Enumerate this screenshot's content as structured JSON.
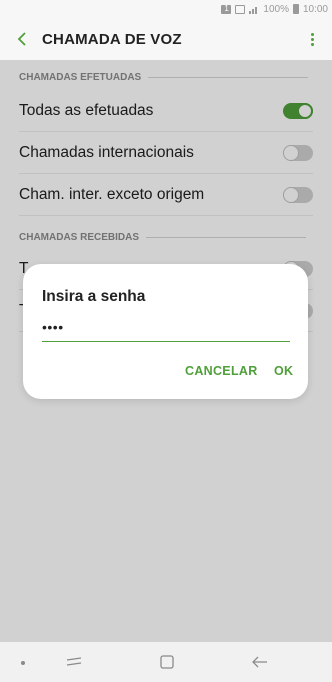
{
  "status_bar": {
    "sim_label": "1",
    "battery_percent": "100%",
    "time": "10:00",
    "icon_color": "#9a9a9a"
  },
  "app_bar": {
    "title": "CHAMADA DE VOZ",
    "back_icon": "back-arrow-icon",
    "more_icon": "more-vert-icon"
  },
  "sections": {
    "outgoing_header": "CHAMADAS EFETUADAS",
    "incoming_header": "CHAMADAS RECEBIDAS"
  },
  "outgoing_items": [
    {
      "label": "Todas as efetuadas",
      "enabled": true
    },
    {
      "label": "Chamadas internacionais",
      "enabled": false
    },
    {
      "label": "Cham. inter. exceto origem",
      "enabled": false
    }
  ],
  "incoming_partial": {
    "row1_visible_fragment": "T",
    "row2_visible_fragment": "T"
  },
  "dialog": {
    "title": "Insira a senha",
    "password_value": "••••",
    "cancel_label": "CANCELAR",
    "ok_label": "OK"
  },
  "colors": {
    "accent": "#4f9f3a",
    "toggle_off_track": "#d0d0d0",
    "toggle_off_knob": "#ffffff"
  }
}
